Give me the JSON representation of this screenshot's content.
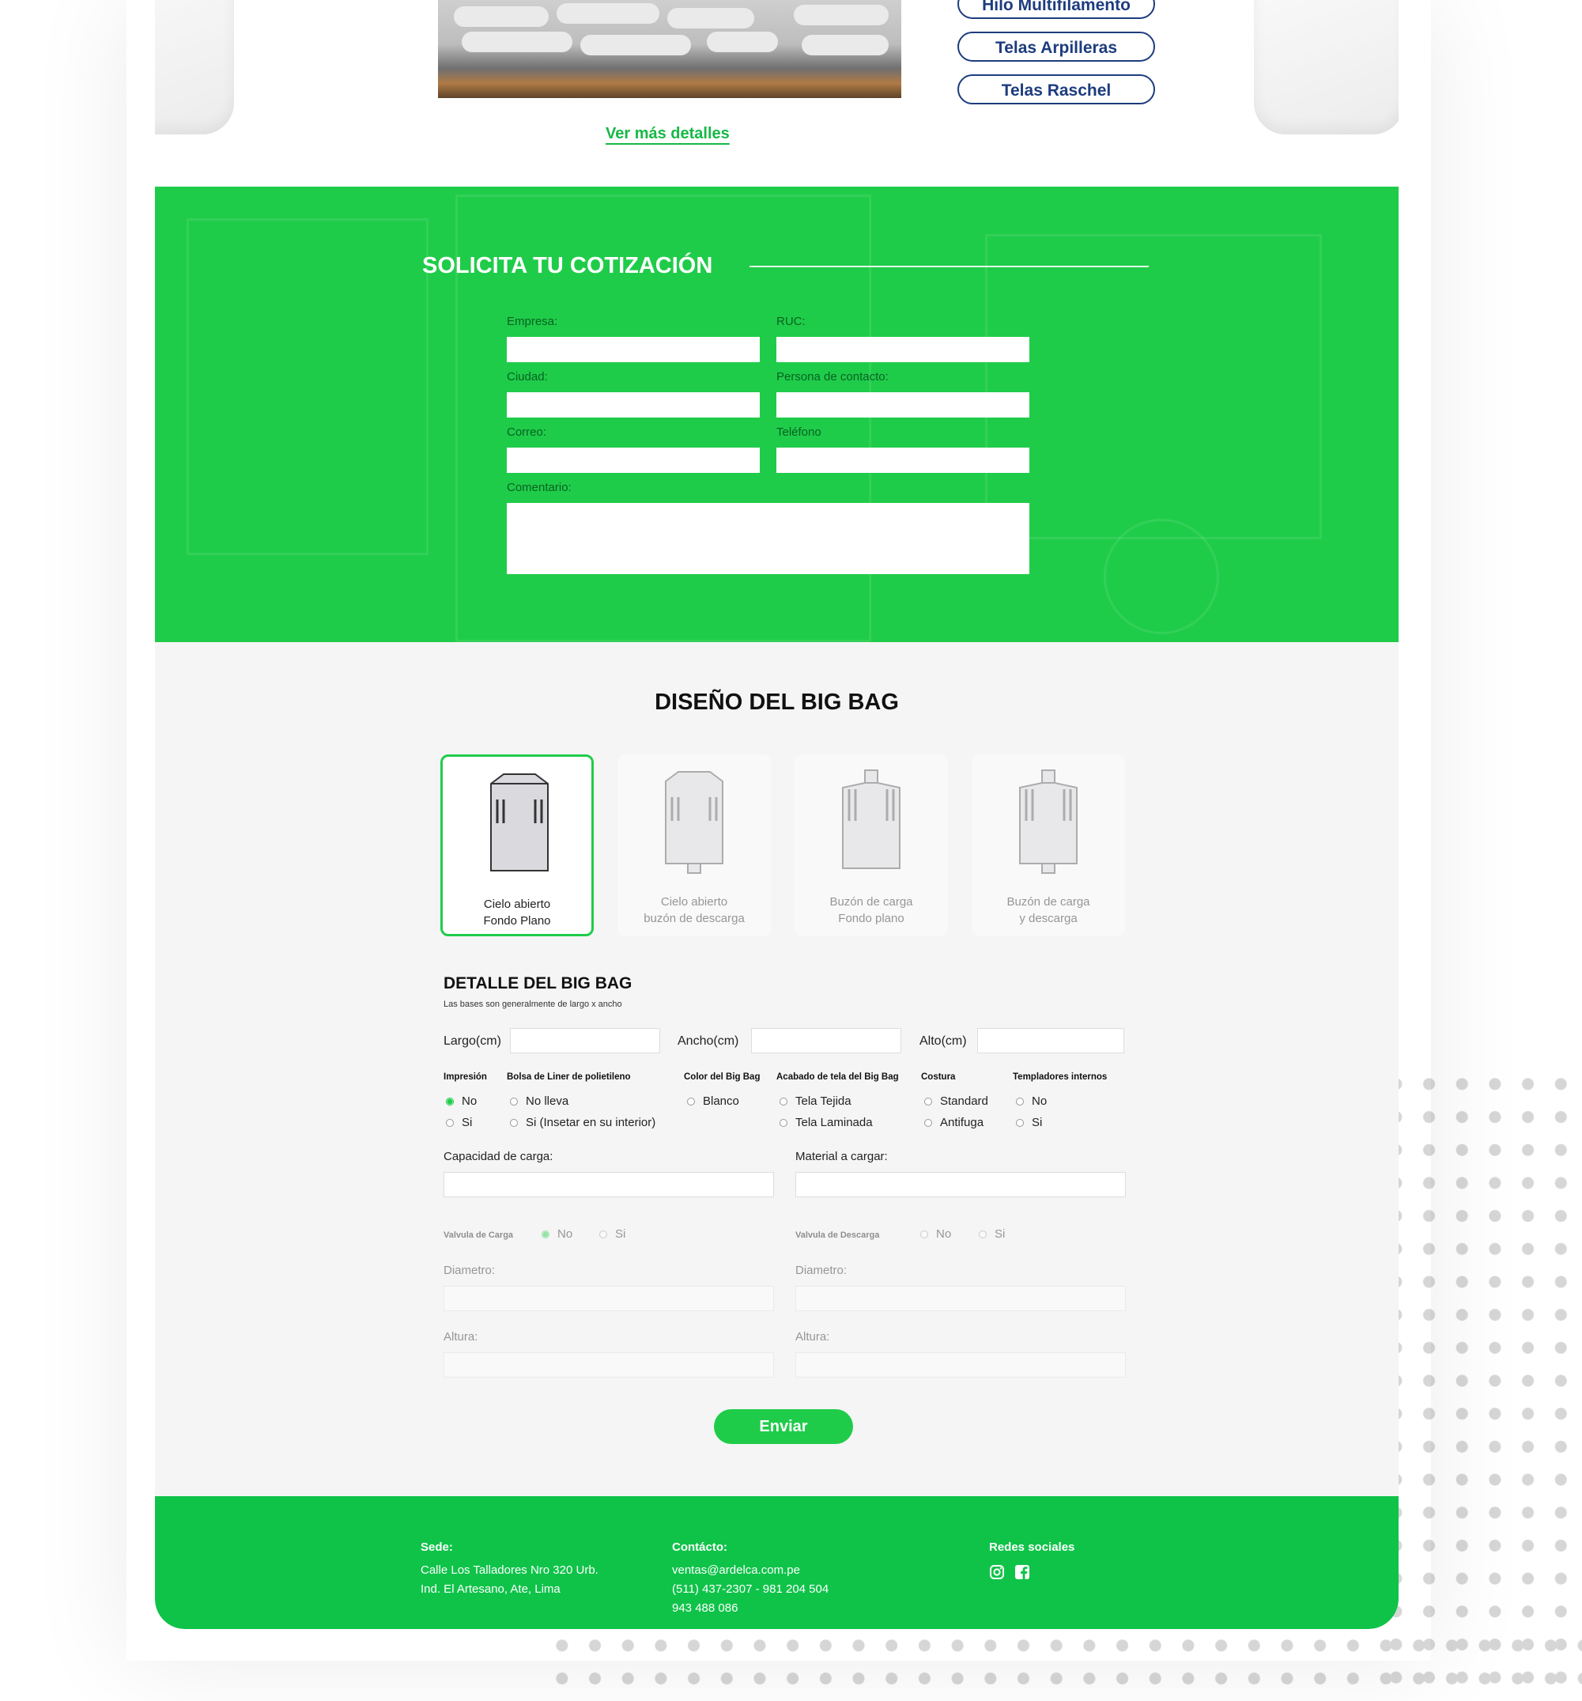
{
  "products_nav": {
    "items": [
      "Hilo Multifilamento",
      "Telas Arpilleras",
      "Telas Raschel"
    ],
    "more_link": "Ver más detalles"
  },
  "quote_form": {
    "title": "SOLICITA TU COTIZACIÓN",
    "fields": {
      "empresa": "Empresa:",
      "ruc": "RUC:",
      "ciudad": "Ciudad:",
      "persona": "Persona de contacto:",
      "correo": "Correo:",
      "telefono": "Teléfono",
      "comentario": "Comentario:"
    }
  },
  "design": {
    "title": "DISEÑO DEL BIG BAG",
    "options": [
      {
        "line1": "Cielo abierto",
        "line2": "Fondo Plano",
        "selected": true
      },
      {
        "line1": "Cielo abierto",
        "line2": "buzón de descarga",
        "selected": false
      },
      {
        "line1": "Buzón de carga",
        "line2": "Fondo plano",
        "selected": false
      },
      {
        "line1": "Buzón de carga",
        "line2": "y descarga",
        "selected": false
      }
    ]
  },
  "detail": {
    "title": "DETALLE DEL BIG BAG",
    "subtitle": "Las bases son generalmente de largo x ancho",
    "largo": "Largo(cm)",
    "ancho": "Ancho(cm)",
    "alto": "Alto(cm)",
    "groups": {
      "impresion": {
        "title": "Impresión",
        "options": [
          "No",
          "Si"
        ],
        "selected": "No"
      },
      "liner": {
        "title": "Bolsa de Liner de polietileno",
        "options": [
          "No lleva",
          "Si (Insetar en su interior)"
        ]
      },
      "color": {
        "title": "Color del Big Bag",
        "options": [
          "Blanco"
        ]
      },
      "acabado": {
        "title": "Acabado de tela del Big Bag",
        "options": [
          "Tela Tejida",
          "Tela Laminada"
        ]
      },
      "costura": {
        "title": "Costura",
        "options": [
          "Standard",
          "Antifuga"
        ]
      },
      "templadores": {
        "title": "Templadores internos",
        "options": [
          "No",
          "Si"
        ]
      }
    },
    "capacidad": "Capacidad de carga:",
    "material": "Material a cargar:",
    "valvula_carga": {
      "title": "Valvula de Carga",
      "options": [
        "No",
        "Si"
      ],
      "selected": "No"
    },
    "valvula_descarga": {
      "title": "Valvula de Descarga",
      "options": [
        "No",
        "Si"
      ]
    },
    "diametro": "Diametro:",
    "altura": "Altura:",
    "submit": "Enviar"
  },
  "footer": {
    "sede_title": "Sede:",
    "sede_line1": "Calle Los Talladores Nro 320 Urb.",
    "sede_line2": "Ind. El Artesano, Ate, Lima",
    "contacto_title": "Contácto:",
    "email": "ventas@ardelca.com.pe",
    "phone1": "(511) 437-2307 - 981 204 504",
    "phone2": "943 488 086",
    "redes_title": "Redes sociales",
    "icons": [
      "instagram-icon",
      "facebook-icon"
    ]
  },
  "colors": {
    "accent": "#1fcc49",
    "navy": "#1d3c7e",
    "footer": "#0fc349"
  }
}
